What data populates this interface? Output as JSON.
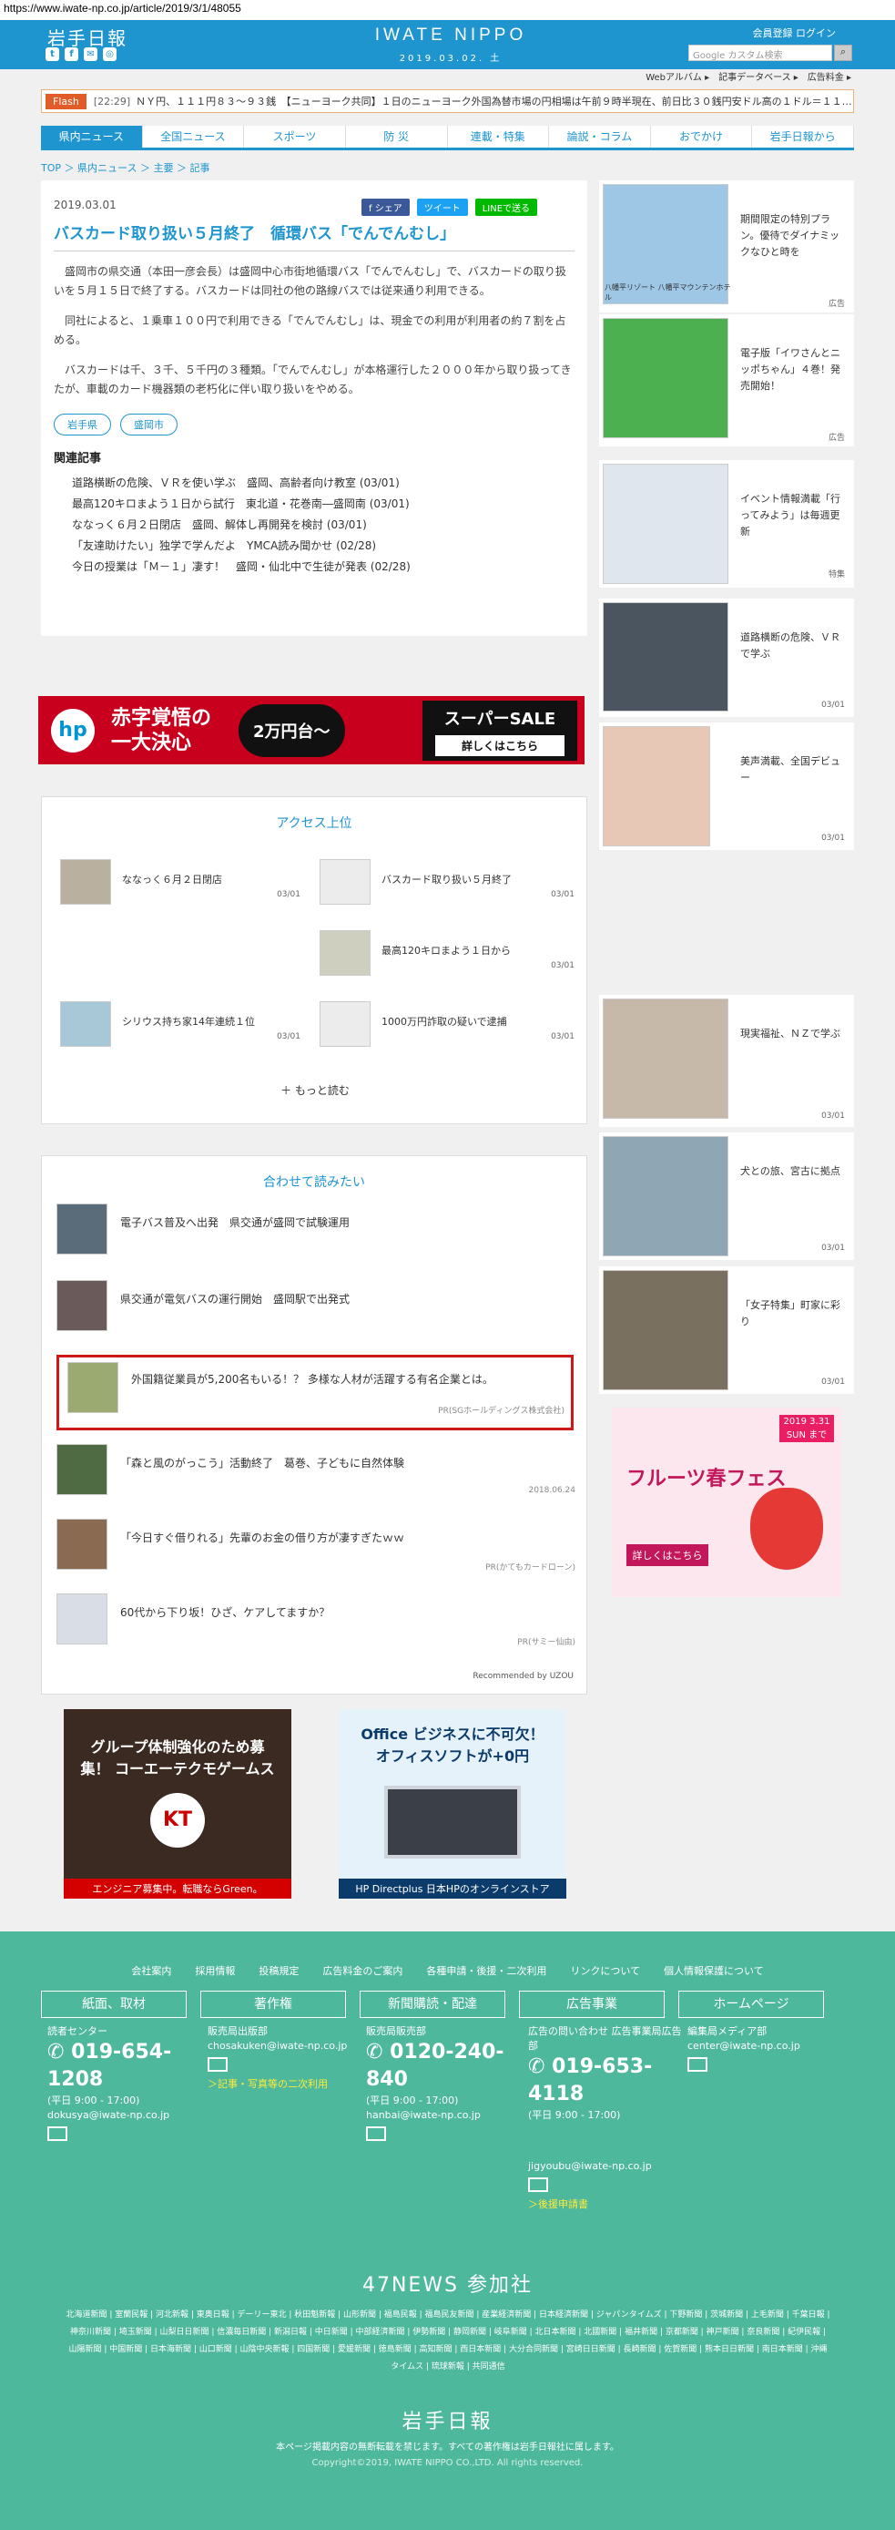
{
  "browser": {
    "url": "https://www.iwate-np.co.jp/article/2019/3/1/48055"
  },
  "header": {
    "logo": "岩手日報",
    "brand": "IWATE NIPPO",
    "date": "2019.03.02. 土",
    "register": "会員登録",
    "login": "ログイン",
    "search_placeholder": "Google カスタム検索",
    "social": [
      "t",
      "f",
      "✉",
      "◎"
    ],
    "toplinks": "Webアルバム ▸　記事データベース ▸　広告料金 ▸"
  },
  "flash": {
    "label": "Flash",
    "time": "[22:29]",
    "text": "ＮＹ円、１１１円８３～９３銭　【ニューヨーク共同】１日のニューヨーク外国為替市場の円相場は午前９時半現在、前日比３０銭円安ドル高の１ドル＝１１…"
  },
  "nav": [
    "県内ニュース",
    "全国ニュース",
    "スポーツ",
    "防 災",
    "連載・特集",
    "論説・コラム",
    "おでかけ",
    "岩手日報から"
  ],
  "breadcrumb": "TOP ＞ 県内ニュース ＞ 主要 ＞ 記事",
  "article": {
    "date": "2019.03.01",
    "share": [
      "f シェア",
      "ツイート",
      "LINEで送る"
    ],
    "title": "バスカード取り扱い５月終了　循環バス「でんでんむし」",
    "paragraphs": [
      "盛岡市の県交通（本田一彦会長）は盛岡中心市街地循環バス「でんでんむし」で、バスカードの取り扱いを５月１５日で終了する。バスカードは同社の他の路線バスでは従来通り利用できる。",
      "同社によると、１乗車１００円で利用できる「でんでんむし」は、現金での利用が利用者の約７割を占める。",
      "バスカードは千、３千、５千円の３種類。「でんでんむし」が本格運行した２０００年から取り扱ってきたが、車載のカード機器類の老朽化に伴い取り扱いをやめる。"
    ],
    "tags": [
      "岩手県",
      "盛岡市"
    ],
    "related_heading": "関連記事",
    "related": [
      "道路横断の危険、ＶＲを使い学ぶ　盛岡、高齢者向け教室 (03/01)",
      "最高120キロまよう１日から試行　東北道・花巻南―盛岡南 (03/01)",
      "ななっく６月２日閉店　盛岡、解体し再開発を検討 (03/01)",
      "「友達助けたい」独学で学んだよ　YMCA読み聞かせ (02/28)",
      "今日の授業は「Ｍ－１」凄す！　盛岡・仙北中で生徒が発表 (02/28)"
    ]
  },
  "ad_banner": {
    "line1": "赤字覚悟の",
    "line2": "一大決心",
    "badge": "2万円台〜",
    "sale": "スーパーSALE",
    "cta": "詳しくはこちら"
  },
  "access": {
    "heading": "アクセス上位",
    "items": [
      {
        "title": "ななっく６月２日閉店",
        "date": "03/01"
      },
      {
        "title": "バスカード取り扱い５月終了",
        "date": "03/01"
      },
      {
        "title": "最高120キロまよう１日から",
        "date": "03/01"
      },
      {
        "title": "シリウス持ち家14年連続１位",
        "date": "03/01"
      },
      {
        "title": "1000万円詐取の疑いで逮捕",
        "date": "03/01"
      }
    ],
    "more": "＋ もっと読む"
  },
  "reco": {
    "heading": "合わせて読みたい",
    "items": [
      {
        "title": "電子バス普及へ出発　県交通が盛岡で試験運用",
        "source": ""
      },
      {
        "title": "県交通が電気バスの運行開始　盛岡駅で出発式",
        "source": ""
      },
      {
        "title": "外国籍従業員が5,200名もいる！？ 多様な人材が活躍する有名企業とは。",
        "source": "PR(SGホールディングス株式会社)"
      },
      {
        "title": "「森と風のがっこう」活動終了　葛巻、子どもに自然体験",
        "source": "2018.06.24"
      },
      {
        "title": "「今日すぐ借りれる」先輩のお金の借り方が凄すぎたｗｗ",
        "source": "PR(かてもカードローン)"
      },
      {
        "title": "60代から下り坂！ひざ、ケアしてますか？",
        "source": "PR(サミー仙由)"
      }
    ],
    "powered": "Recommended by UZOU"
  },
  "side": [
    {
      "title": "期間限定の特別プラン。優待でダイナミックなひと時を",
      "note": "広告",
      "label": "八幡平リゾート 八幡平マウンテンホテル"
    },
    {
      "title": "電子版「イワさんとニッポちゃん」４巻！発売開始！",
      "note": "広告"
    },
    {
      "title": "イベント情報満載「行ってみよう」は毎週更新",
      "note": "特集"
    },
    {
      "title": "道路横断の危険、ＶＲで学ぶ",
      "note": "03/01"
    },
    {
      "title": "美声満載、全国デビュー",
      "note": "03/01"
    },
    {
      "title": "現実福祉、ＮＺで学ぶ",
      "note": "03/01"
    },
    {
      "title": "犬との旅、宮古に拠点",
      "note": "03/01"
    },
    {
      "title": "「女子特集」町家に彩り",
      "note": "03/01"
    }
  ],
  "side_ad": {
    "date": "2019 3.31 SUN まで",
    "title": "フルーツ春フェス",
    "cta": "詳しくはこちら"
  },
  "bottom_ads": [
    {
      "text": "グループ体制強化のため募集！ コーエーテクモゲームス",
      "foot": "エンジニア募集中。転職ならGreen。"
    },
    {
      "text": "Office ビジネスに不可欠！ オフィスソフトが+0円",
      "foot": "HP Directplus 日本HPのオンラインストア"
    }
  ],
  "footer": {
    "links": [
      "会社案内",
      "採用情報",
      "投稿規定",
      "広告料金のご案内",
      "各種申請・後援・二次利用",
      "リンクについて",
      "個人情報保護について"
    ],
    "buttons": [
      "紙面、取材",
      "著作権",
      "新聞購読・配達",
      "広告事業",
      "ホームページ"
    ],
    "cols": [
      {
        "name": "読者センター",
        "phone": "019-654-1208",
        "hours": "(平日 9:00 - 17:00)",
        "mail": "dokusya@iwate-np.co.jp",
        "extra": ""
      },
      {
        "name": "販売局出版部",
        "phone": "",
        "hours": "",
        "mail": "chosakuken@iwate-np.co.jp",
        "extra": "＞記事・写真等の二次利用"
      },
      {
        "name": "販売局販売部",
        "phone": "0120-240-840",
        "hours": "(平日 9:00 - 17:00)",
        "mail": "hanbai@iwate-np.co.jp",
        "extra": ""
      },
      {
        "name": "広告の問い合わせ 広告事業局広告部",
        "phone": "019-653-4118",
        "hours": "(平日 9:00 - 17:00)",
        "mail": "jigyoubu@iwate-np.co.jp",
        "extra": "＞後援申請書"
      },
      {
        "name": "編集局メディア部",
        "phone": "",
        "hours": "",
        "mail": "center@iwate-np.co.jp",
        "extra": ""
      }
    ],
    "news47": "47NEWS 参加社",
    "papers": "北海道新聞 | 室蘭民報 | 河北新報 | 東奥日報 | デーリー東北 | 秋田魁新報 | 山形新聞 | 福島民報 | 福島民友新聞 | 産業経済新聞 | 日本経済新聞 | ジャパンタイムズ | 下野新聞 | 茨城新聞 | 上毛新聞 | 千葉日報 | 神奈川新聞 | 埼玉新聞 | 山梨日日新聞 | 信濃毎日新聞 | 新潟日報 | 中日新聞 | 中部経済新聞 | 伊勢新聞 | 静岡新聞 | 岐阜新聞 | 北日本新聞 | 北國新聞 | 福井新聞 | 京都新聞 | 神戸新聞 | 奈良新聞 | 紀伊民報 | 山陽新聞 | 中国新聞 | 日本海新聞 | 山口新聞 | 山陰中央新報 | 四国新聞 | 愛媛新聞 | 徳島新聞 | 高知新聞 | 西日本新聞 | 大分合同新聞 | 宮崎日日新聞 | 長崎新聞 | 佐賀新聞 | 熊本日日新聞 | 南日本新聞 | 沖縄タイムス | 琉球新報 | 共同通信",
    "logo": "岩手日報",
    "notice": "本ページ掲載内容の無断転載を禁じます。すべての著作権は岩手日報社に属します。",
    "copyright": "Copyright©2019, IWATE NIPPO CO.,LTD. All rights reserved."
  }
}
